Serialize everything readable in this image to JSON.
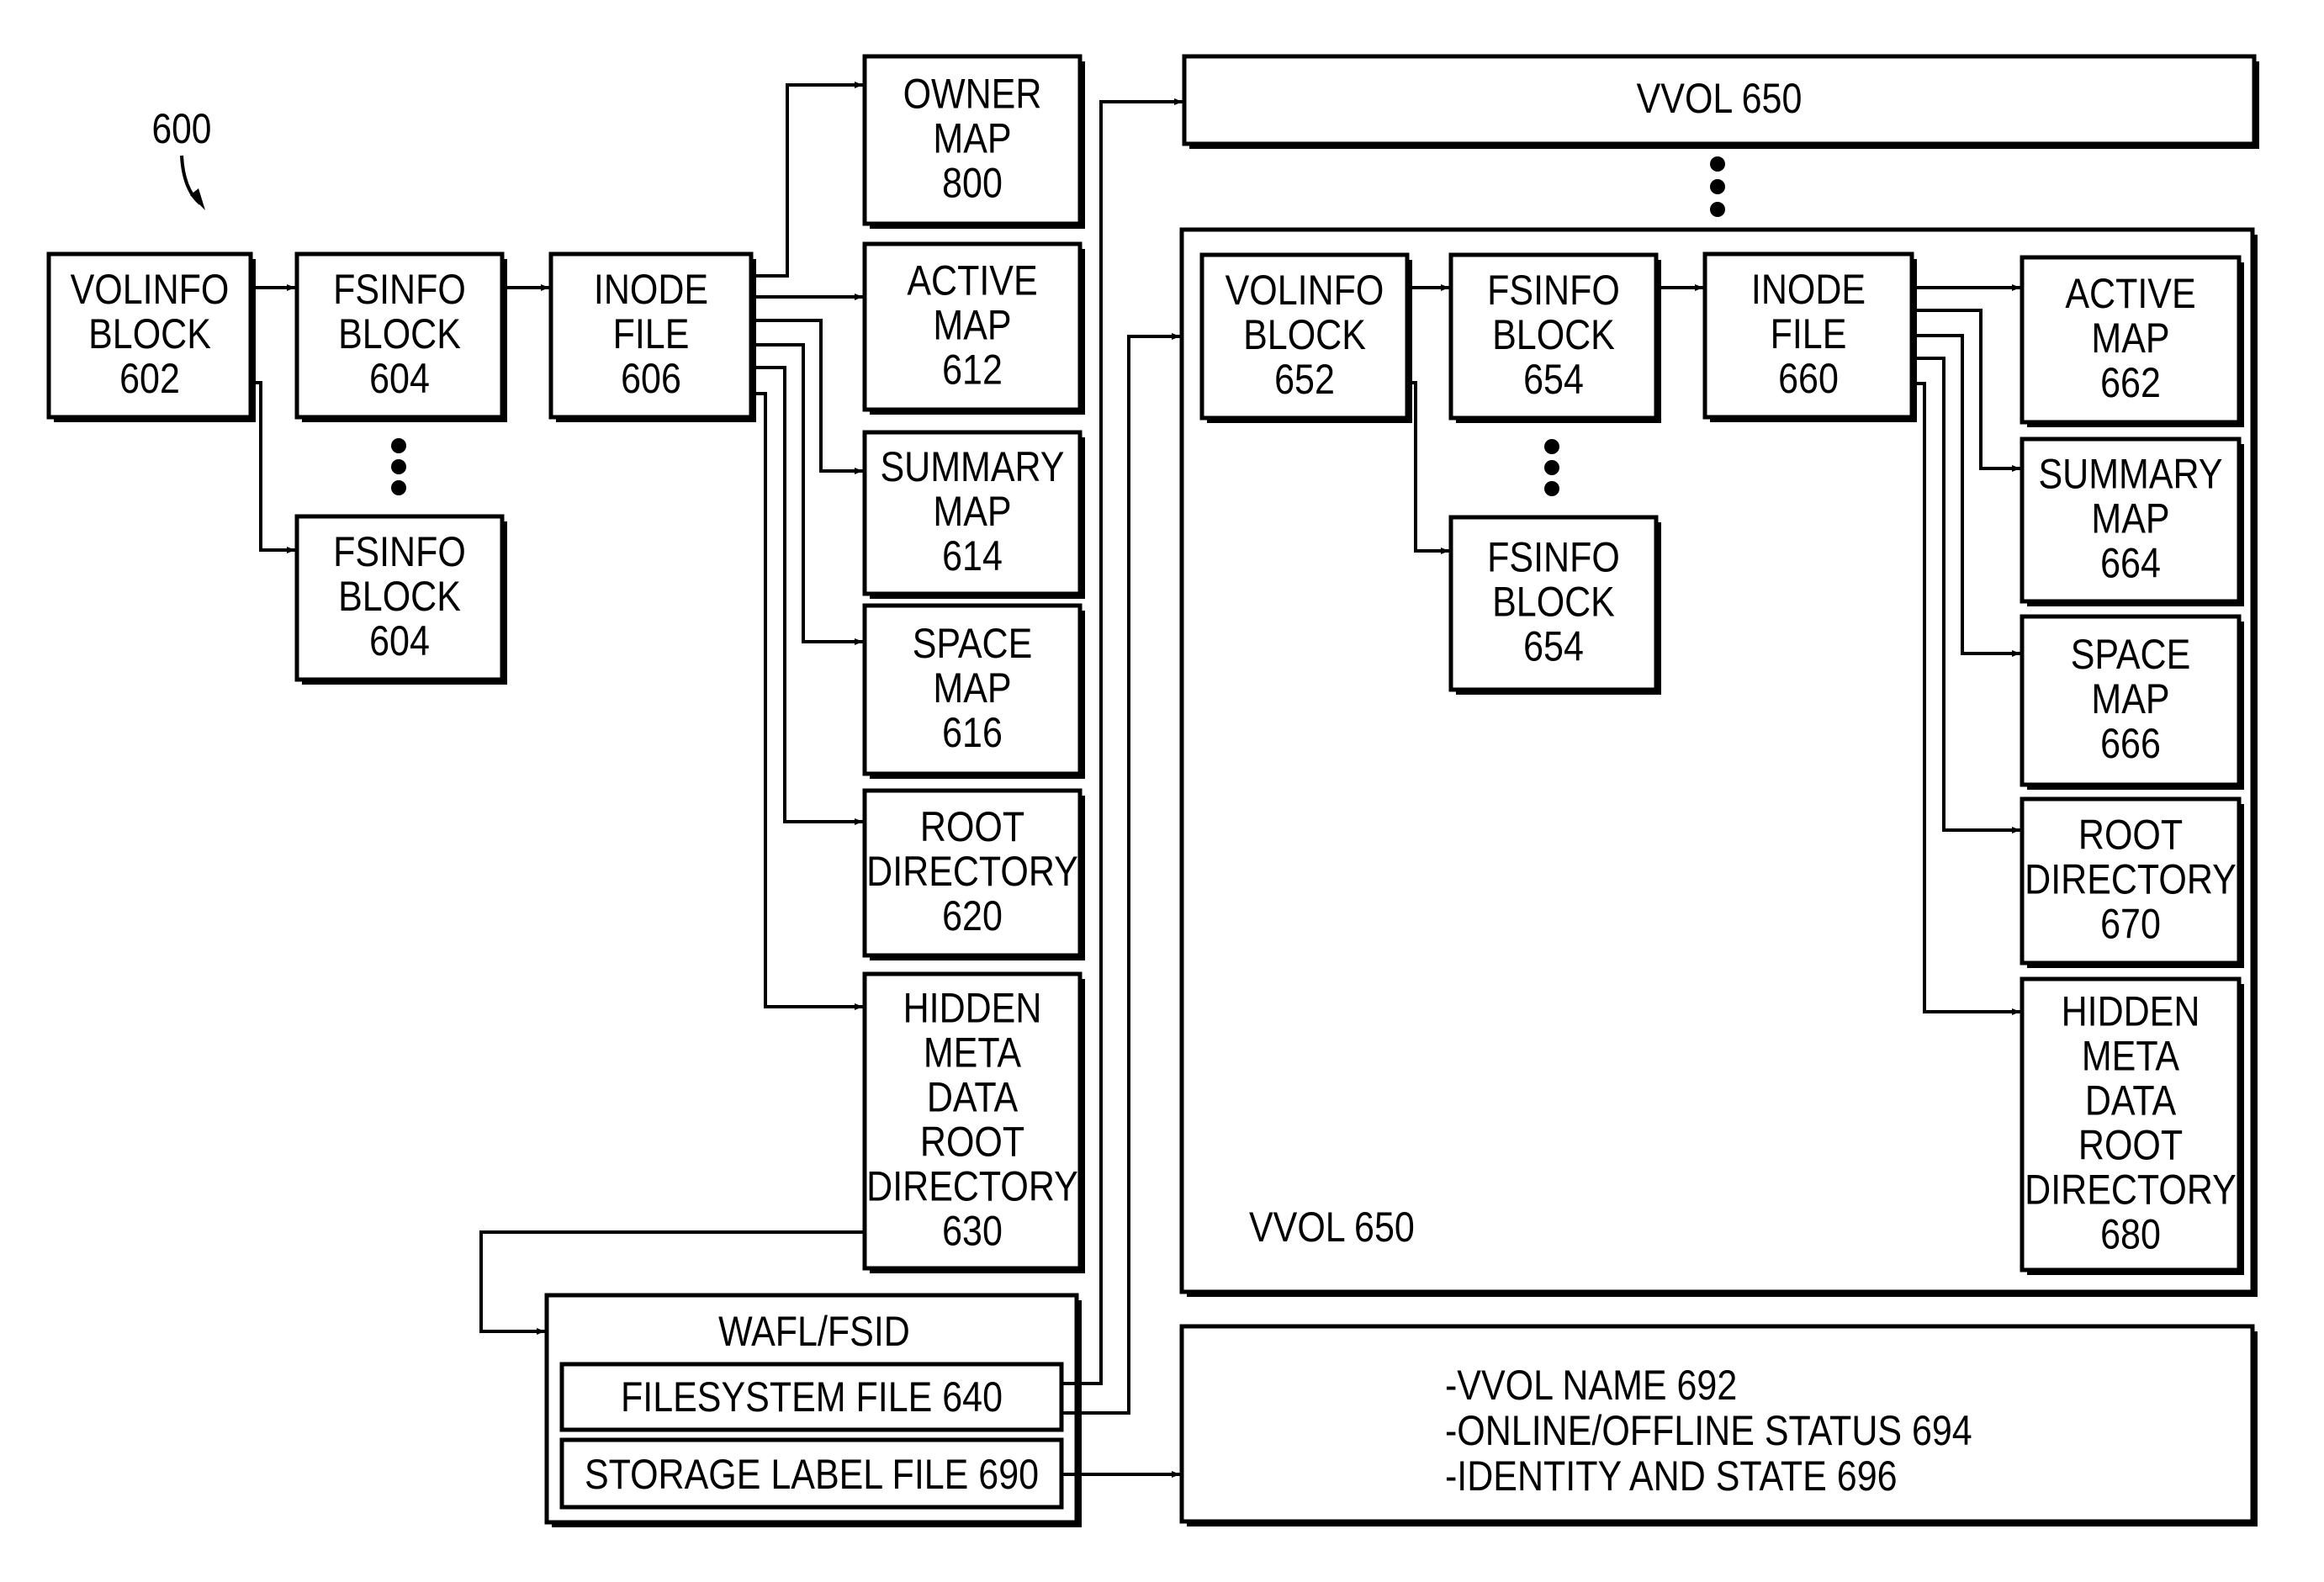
{
  "figure": {
    "ref_label": "600",
    "colors": {
      "ink": "#000000",
      "paper": "#ffffff"
    }
  },
  "left": {
    "volinfo": [
      "VOLINFO",
      "BLOCK",
      "602"
    ],
    "fsinfo": [
      "FSINFO",
      "BLOCK",
      "604"
    ],
    "fsinfo_copy": [
      "FSINFO",
      "BLOCK",
      "604"
    ],
    "inode": [
      "INODE",
      "FILE",
      "606"
    ],
    "owner_map": [
      "OWNER",
      "MAP",
      "800"
    ],
    "active_map": [
      "ACTIVE",
      "MAP",
      "612"
    ],
    "summary_map": [
      "SUMMARY",
      "MAP",
      "614"
    ],
    "space_map": [
      "SPACE",
      "MAP",
      "616"
    ],
    "root_dir": [
      "ROOT",
      "DIRECTORY",
      "620"
    ],
    "hidden_root": [
      "HIDDEN",
      "META",
      "DATA",
      "ROOT",
      "DIRECTORY",
      "630"
    ],
    "wafl": {
      "title": "WAFL/FSID",
      "filesystem_file": "FILESYSTEM FILE  640",
      "storage_label_file": "STORAGE LABEL FILE 690"
    }
  },
  "right": {
    "vvol_top": "VVOL 650",
    "vvol_container_label": "VVOL 650",
    "volinfo": [
      "VOLINFO",
      "BLOCK",
      "652"
    ],
    "fsinfo": [
      "FSINFO",
      "BLOCK",
      "654"
    ],
    "fsinfo_copy": [
      "FSINFO",
      "BLOCK",
      "654"
    ],
    "inode": [
      "INODE",
      "FILE",
      "660"
    ],
    "active_map": [
      "ACTIVE",
      "MAP",
      "662"
    ],
    "summary_map": [
      "SUMMARY",
      "MAP",
      "664"
    ],
    "space_map": [
      "SPACE",
      "MAP",
      "666"
    ],
    "root_dir": [
      "ROOT",
      "DIRECTORY",
      "670"
    ],
    "hidden_root": [
      "HIDDEN",
      "META",
      "DATA",
      "ROOT",
      "DIRECTORY",
      "680"
    ],
    "label_info": [
      "-VVOL NAME 692",
      "-ONLINE/OFFLINE STATUS 694",
      "-IDENTITY AND STATE 696"
    ]
  }
}
